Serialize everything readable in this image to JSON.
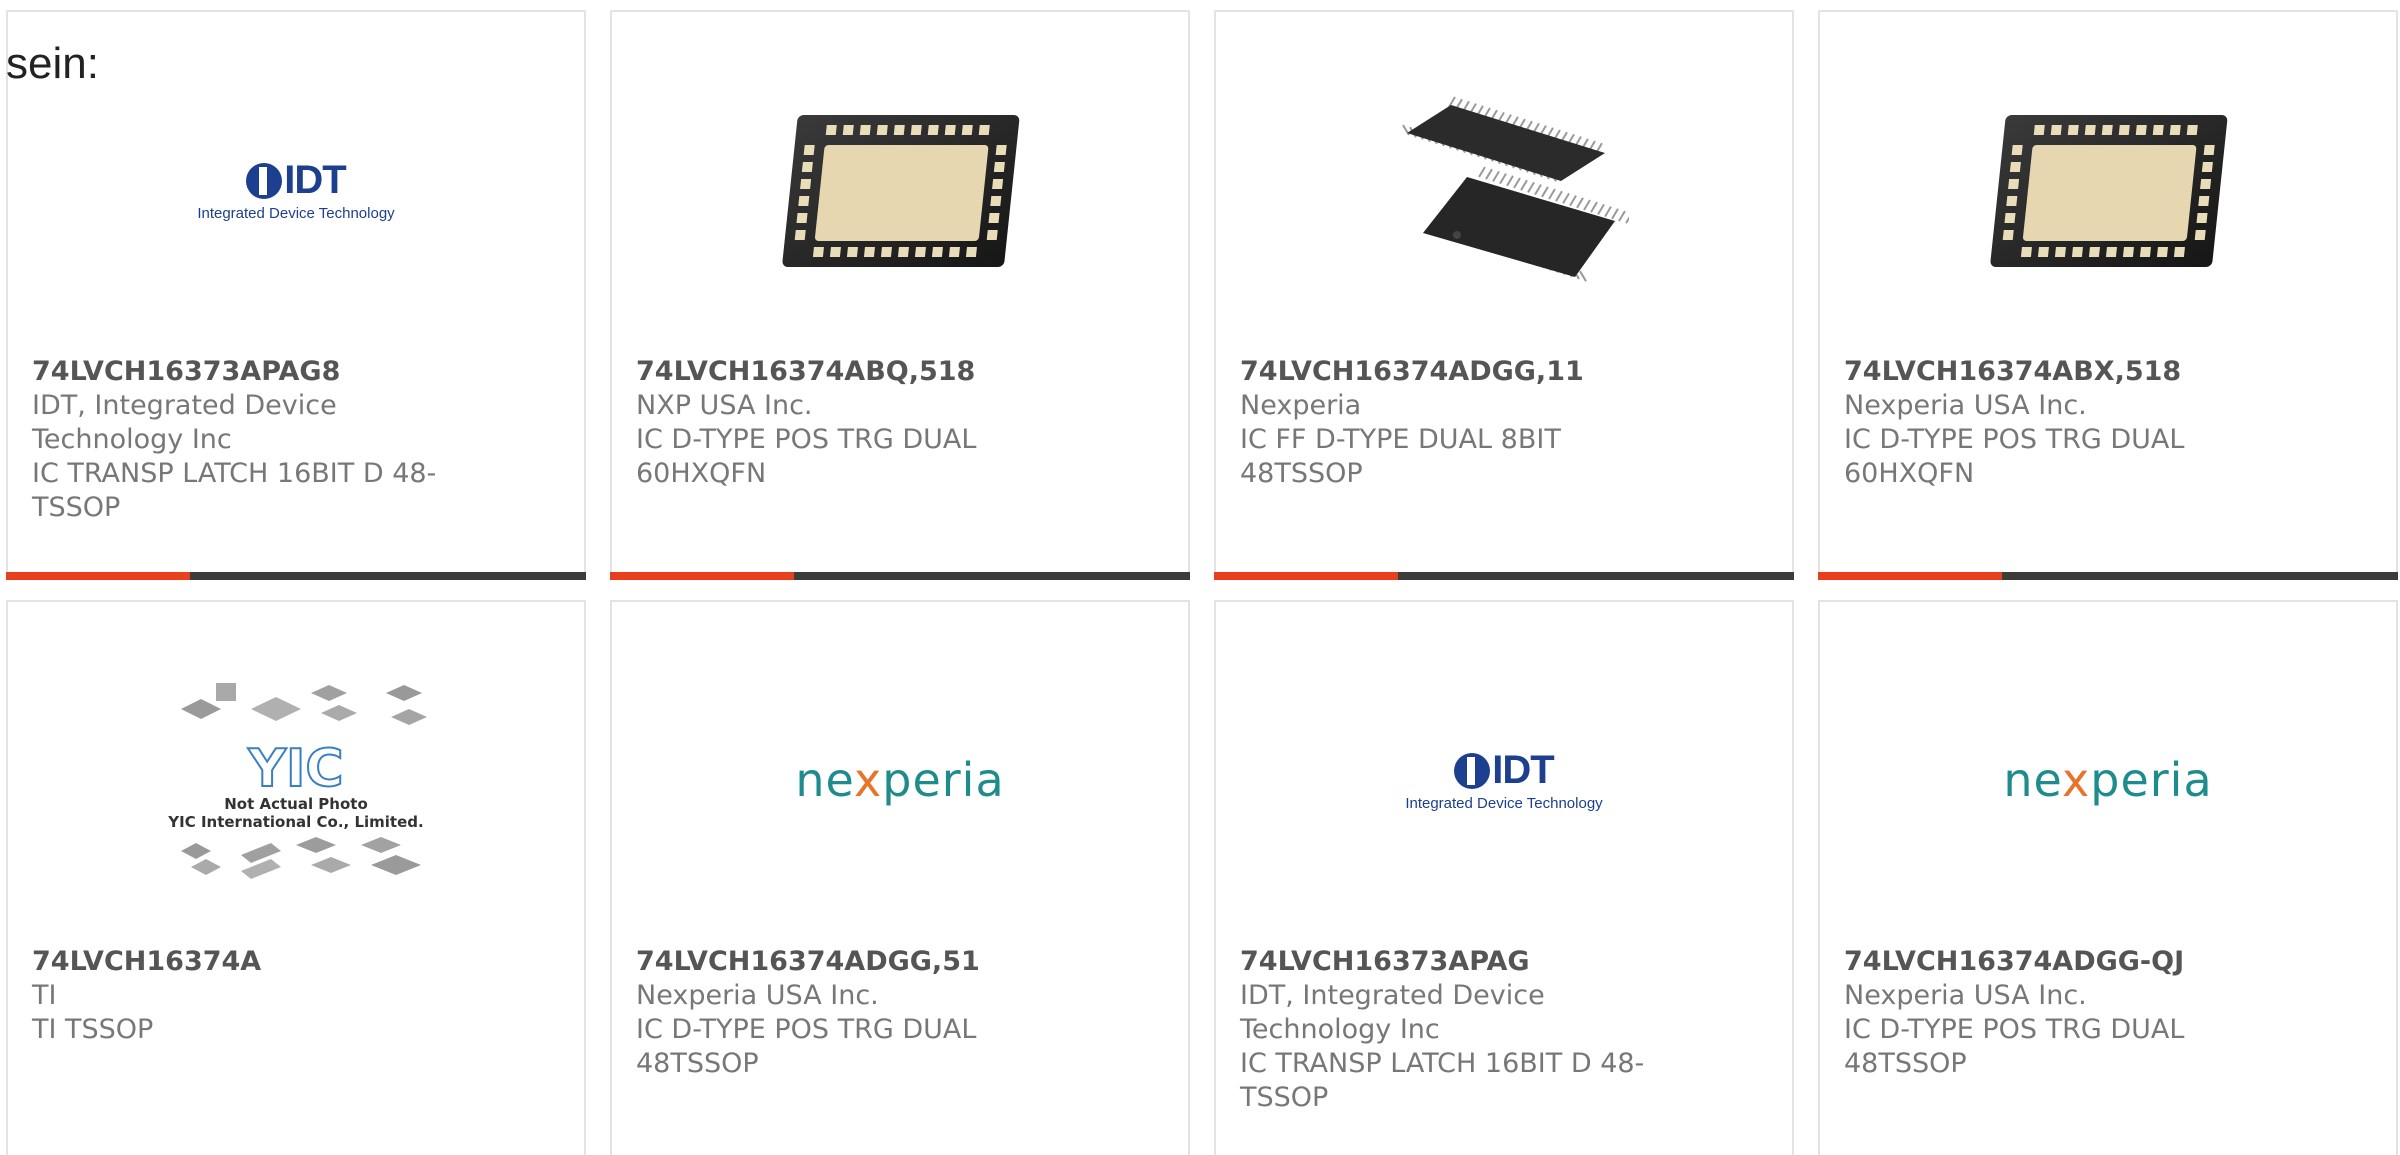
{
  "prefix_text": "sein:",
  "colors": {
    "accent": "#e8401c",
    "bar": "#3c3c3c",
    "border": "#e3e3e3",
    "idt_blue": "#1c3f8f",
    "nexperia_teal": "#1e8c8c",
    "nexperia_orange": "#e8732a"
  },
  "products": [
    {
      "part_number": "74LVCH16373APAG8",
      "manufacturer": "IDT, Integrated Device Technology Inc",
      "description": "IC TRANSP LATCH 16BIT D 48-TSSOP",
      "image": "idt-logo",
      "logo_text": "IDT",
      "logo_subtext": "Integrated Device Technology"
    },
    {
      "part_number": "74LVCH16374ABQ,518",
      "manufacturer": "NXP USA Inc.",
      "description": "IC D-TYPE POS TRG DUAL 60HXQFN",
      "image": "qfn-chip-photo"
    },
    {
      "part_number": "74LVCH16374ADGG,11",
      "manufacturer": "Nexperia",
      "description": "IC FF D-TYPE DUAL 8BIT 48TSSOP",
      "image": "tssop-chip-photo"
    },
    {
      "part_number": "74LVCH16374ABX,518",
      "manufacturer": "Nexperia USA Inc.",
      "description": "IC D-TYPE POS TRG DUAL 60HXQFN",
      "image": "qfn-chip-photo"
    },
    {
      "part_number": "74LVCH16374A",
      "manufacturer": "TI",
      "description": "TI TSSOP",
      "image": "yic-placeholder",
      "logo_text": "YIC",
      "note_line1": "Not Actual Photo",
      "note_line2": "YIC International Co., Limited."
    },
    {
      "part_number": "74LVCH16374ADGG,51",
      "manufacturer": "Nexperia USA Inc.",
      "description": "IC D-TYPE POS TRG DUAL 48TSSOP",
      "image": "nexperia-logo",
      "logo_pre": "ne",
      "logo_x": "x",
      "logo_post": "peria"
    },
    {
      "part_number": "74LVCH16373APAG",
      "manufacturer": "IDT, Integrated Device Technology Inc",
      "description": "IC TRANSP LATCH 16BIT D 48-TSSOP",
      "image": "idt-logo",
      "logo_text": "IDT",
      "logo_subtext": "Integrated Device Technology"
    },
    {
      "part_number": "74LVCH16374ADGG-QJ",
      "manufacturer": "Nexperia USA Inc.",
      "description": "IC D-TYPE POS TRG DUAL 48TSSOP",
      "image": "nexperia-logo",
      "logo_pre": "ne",
      "logo_x": "x",
      "logo_post": "peria"
    }
  ]
}
